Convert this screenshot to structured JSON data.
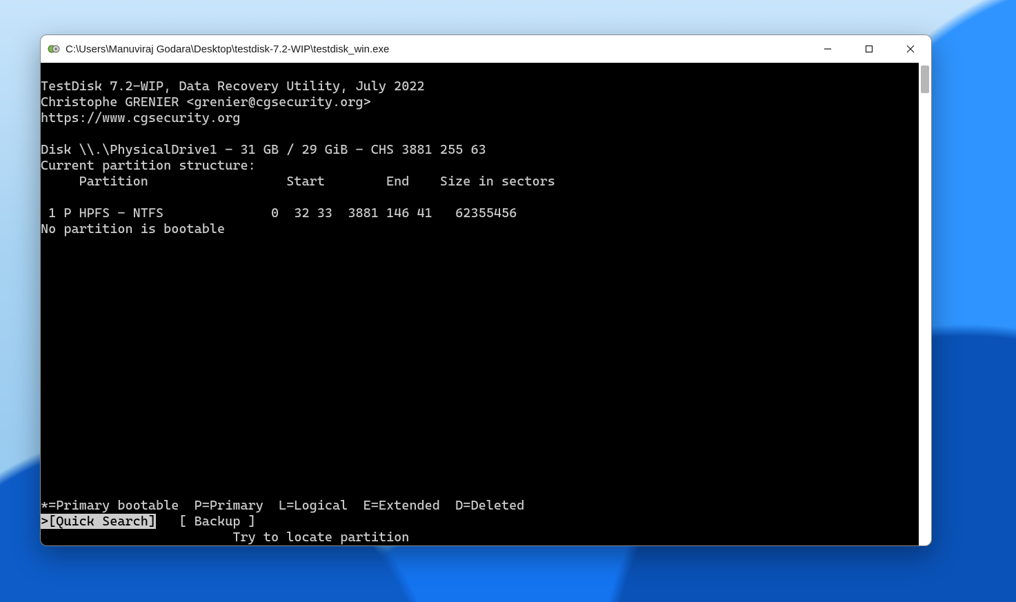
{
  "window": {
    "title": "C:\\Users\\Manuviraj Godara\\Desktop\\testdisk-7.2-WIP\\testdisk_win.exe"
  },
  "terminal": {
    "header1": "TestDisk 7.2-WIP, Data Recovery Utility, July 2022",
    "header2": "Christophe GRENIER <grenier@cgsecurity.org>",
    "header3": "https://www.cgsecurity.org",
    "blank": "",
    "disk_line": "Disk \\\\.\\PhysicalDrive1 - 31 GB / 29 GiB - CHS 3881 255 63",
    "struct_line": "Current partition structure:",
    "col_header": "     Partition                  Start        End    Size in sectors",
    "part_row": " 1 P HPFS - NTFS              0  32 33  3881 146 41   62355456",
    "no_boot": "No partition is bootable",
    "legend": "*=Primary bootable  P=Primary  L=Logical  E=Extended  D=Deleted",
    "menu_prefix": ">",
    "menu_sel": "[Quick Search]",
    "menu_gap": "   ",
    "menu_backup": "[ Backup ]",
    "hint_pad": "                         ",
    "hint": "Try to locate partition"
  }
}
